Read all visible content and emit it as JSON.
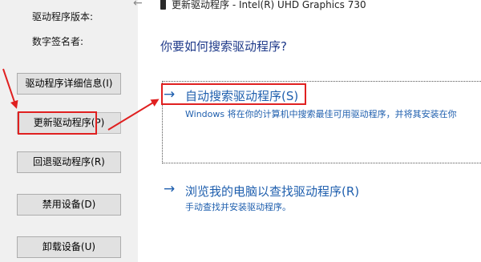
{
  "left_panel": {
    "labels": {
      "driver_version": "驱动程序版本:",
      "signer": "数字签名者:"
    },
    "buttons": {
      "details": "驱动程序详细信息(I)",
      "update": "更新驱动程序(P)",
      "rollback": "回退驱动程序(R)",
      "disable": "禁用设备(D)",
      "uninstall": "卸载设备(U)"
    }
  },
  "dialog": {
    "title": "更新驱动程序 - Intel(R) UHD Graphics 730",
    "question": "你要如何搜索驱动程序?",
    "option_auto": {
      "title": "自动搜索驱动程序(S)",
      "desc": "Windows 将在你的计算机中搜索最佳可用驱动程序，并将其安装在你"
    },
    "option_browse": {
      "title": "浏览我的电脑以查找驱动程序(R)",
      "desc": "手动查找并安装驱动程序。"
    },
    "arrow_glyph": "→"
  },
  "colors": {
    "link": "#1f5fae",
    "annotation": "#e02020",
    "heading": "#1f3a8a"
  }
}
